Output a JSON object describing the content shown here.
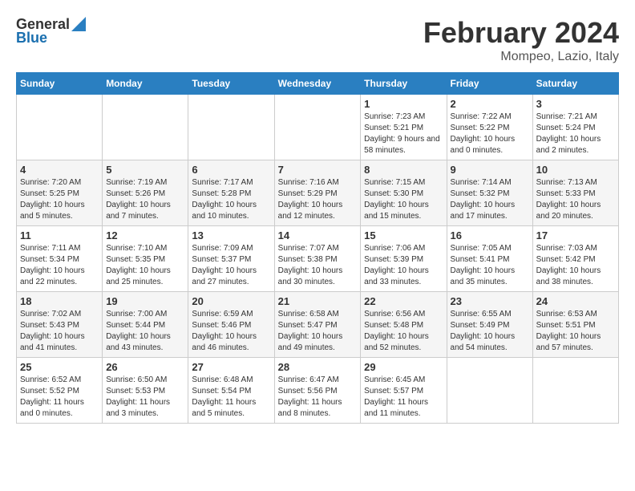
{
  "header": {
    "logo_general": "General",
    "logo_blue": "Blue",
    "title": "February 2024",
    "subtitle": "Mompeo, Lazio, Italy"
  },
  "columns": [
    "Sunday",
    "Monday",
    "Tuesday",
    "Wednesday",
    "Thursday",
    "Friday",
    "Saturday"
  ],
  "weeks": [
    [
      {
        "day": "",
        "info": ""
      },
      {
        "day": "",
        "info": ""
      },
      {
        "day": "",
        "info": ""
      },
      {
        "day": "",
        "info": ""
      },
      {
        "day": "1",
        "info": "Sunrise: 7:23 AM\nSunset: 5:21 PM\nDaylight: 9 hours and 58 minutes."
      },
      {
        "day": "2",
        "info": "Sunrise: 7:22 AM\nSunset: 5:22 PM\nDaylight: 10 hours and 0 minutes."
      },
      {
        "day": "3",
        "info": "Sunrise: 7:21 AM\nSunset: 5:24 PM\nDaylight: 10 hours and 2 minutes."
      }
    ],
    [
      {
        "day": "4",
        "info": "Sunrise: 7:20 AM\nSunset: 5:25 PM\nDaylight: 10 hours and 5 minutes."
      },
      {
        "day": "5",
        "info": "Sunrise: 7:19 AM\nSunset: 5:26 PM\nDaylight: 10 hours and 7 minutes."
      },
      {
        "day": "6",
        "info": "Sunrise: 7:17 AM\nSunset: 5:28 PM\nDaylight: 10 hours and 10 minutes."
      },
      {
        "day": "7",
        "info": "Sunrise: 7:16 AM\nSunset: 5:29 PM\nDaylight: 10 hours and 12 minutes."
      },
      {
        "day": "8",
        "info": "Sunrise: 7:15 AM\nSunset: 5:30 PM\nDaylight: 10 hours and 15 minutes."
      },
      {
        "day": "9",
        "info": "Sunrise: 7:14 AM\nSunset: 5:32 PM\nDaylight: 10 hours and 17 minutes."
      },
      {
        "day": "10",
        "info": "Sunrise: 7:13 AM\nSunset: 5:33 PM\nDaylight: 10 hours and 20 minutes."
      }
    ],
    [
      {
        "day": "11",
        "info": "Sunrise: 7:11 AM\nSunset: 5:34 PM\nDaylight: 10 hours and 22 minutes."
      },
      {
        "day": "12",
        "info": "Sunrise: 7:10 AM\nSunset: 5:35 PM\nDaylight: 10 hours and 25 minutes."
      },
      {
        "day": "13",
        "info": "Sunrise: 7:09 AM\nSunset: 5:37 PM\nDaylight: 10 hours and 27 minutes."
      },
      {
        "day": "14",
        "info": "Sunrise: 7:07 AM\nSunset: 5:38 PM\nDaylight: 10 hours and 30 minutes."
      },
      {
        "day": "15",
        "info": "Sunrise: 7:06 AM\nSunset: 5:39 PM\nDaylight: 10 hours and 33 minutes."
      },
      {
        "day": "16",
        "info": "Sunrise: 7:05 AM\nSunset: 5:41 PM\nDaylight: 10 hours and 35 minutes."
      },
      {
        "day": "17",
        "info": "Sunrise: 7:03 AM\nSunset: 5:42 PM\nDaylight: 10 hours and 38 minutes."
      }
    ],
    [
      {
        "day": "18",
        "info": "Sunrise: 7:02 AM\nSunset: 5:43 PM\nDaylight: 10 hours and 41 minutes."
      },
      {
        "day": "19",
        "info": "Sunrise: 7:00 AM\nSunset: 5:44 PM\nDaylight: 10 hours and 43 minutes."
      },
      {
        "day": "20",
        "info": "Sunrise: 6:59 AM\nSunset: 5:46 PM\nDaylight: 10 hours and 46 minutes."
      },
      {
        "day": "21",
        "info": "Sunrise: 6:58 AM\nSunset: 5:47 PM\nDaylight: 10 hours and 49 minutes."
      },
      {
        "day": "22",
        "info": "Sunrise: 6:56 AM\nSunset: 5:48 PM\nDaylight: 10 hours and 52 minutes."
      },
      {
        "day": "23",
        "info": "Sunrise: 6:55 AM\nSunset: 5:49 PM\nDaylight: 10 hours and 54 minutes."
      },
      {
        "day": "24",
        "info": "Sunrise: 6:53 AM\nSunset: 5:51 PM\nDaylight: 10 hours and 57 minutes."
      }
    ],
    [
      {
        "day": "25",
        "info": "Sunrise: 6:52 AM\nSunset: 5:52 PM\nDaylight: 11 hours and 0 minutes."
      },
      {
        "day": "26",
        "info": "Sunrise: 6:50 AM\nSunset: 5:53 PM\nDaylight: 11 hours and 3 minutes."
      },
      {
        "day": "27",
        "info": "Sunrise: 6:48 AM\nSunset: 5:54 PM\nDaylight: 11 hours and 5 minutes."
      },
      {
        "day": "28",
        "info": "Sunrise: 6:47 AM\nSunset: 5:56 PM\nDaylight: 11 hours and 8 minutes."
      },
      {
        "day": "29",
        "info": "Sunrise: 6:45 AM\nSunset: 5:57 PM\nDaylight: 11 hours and 11 minutes."
      },
      {
        "day": "",
        "info": ""
      },
      {
        "day": "",
        "info": ""
      }
    ]
  ]
}
